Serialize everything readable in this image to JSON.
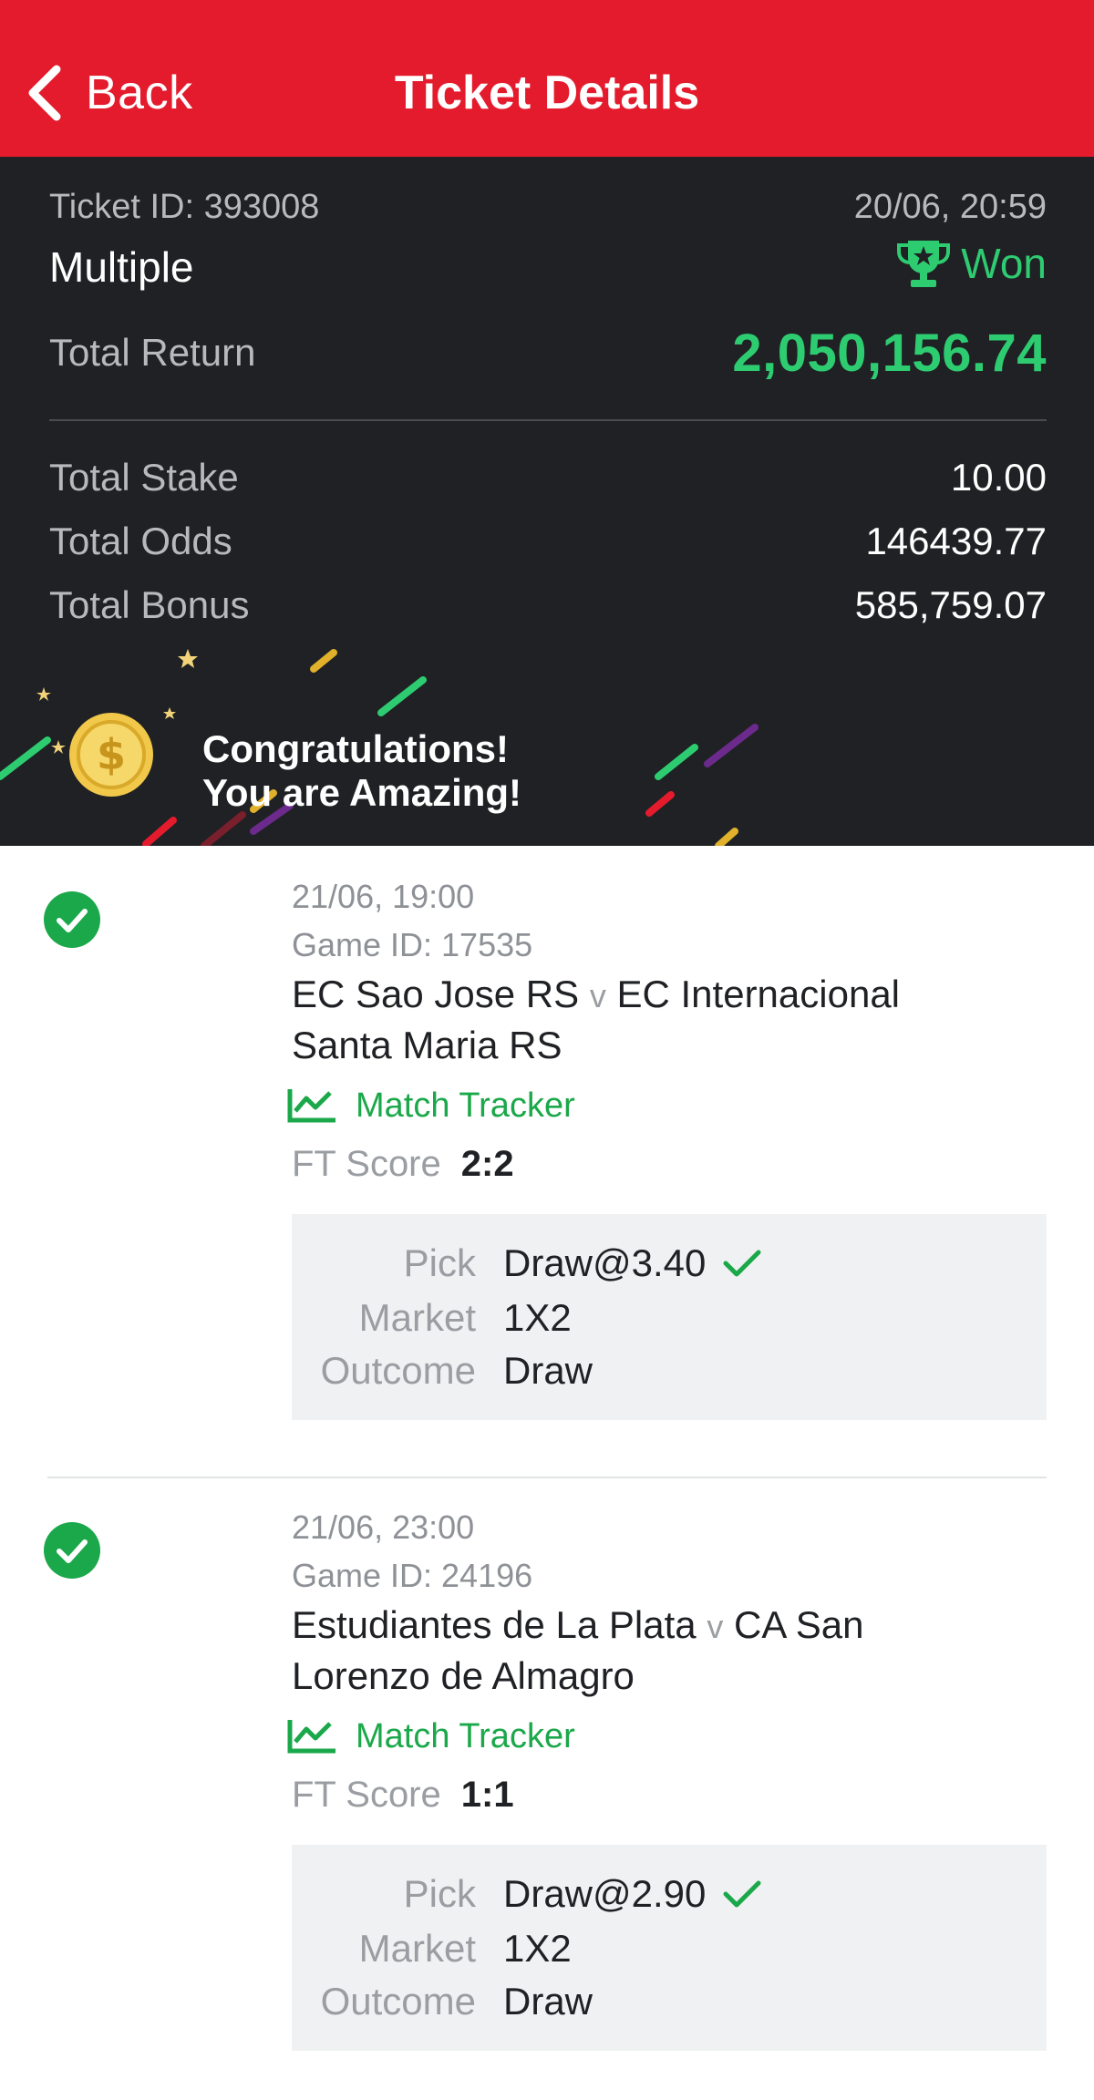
{
  "header": {
    "back_label": "Back",
    "title": "Ticket Details"
  },
  "summary": {
    "ticket_id": "Ticket ID: 393008",
    "datetime": "20/06, 20:59",
    "status": "Won",
    "type": "Multiple",
    "total_return_label": "Total Return",
    "total_return_value": "2,050,156.74",
    "stats": [
      {
        "label": "Total Stake",
        "value": "10.00"
      },
      {
        "label": "Total Odds",
        "value": "146439.77"
      },
      {
        "label": "Total Bonus",
        "value": "585,759.07"
      }
    ],
    "congrats_line1": "Congratulations!",
    "congrats_line2": "You are Amazing!"
  },
  "selections": [
    {
      "datetime": "21/06, 19:00",
      "game_id": "Game ID: 17535",
      "home": "EC Sao Jose RS",
      "vs": "v",
      "away_line1": "EC Internacional",
      "away_line2": "Santa Maria RS",
      "tracker_label": "Match Tracker",
      "ft_label": "FT Score",
      "ft_value": "2:2",
      "pick_label": "Pick",
      "pick_value": "Draw@3.40",
      "market_label": "Market",
      "market_value": "1X2",
      "outcome_label": "Outcome",
      "outcome_value": "Draw"
    },
    {
      "datetime": "21/06, 23:00",
      "game_id": "Game ID: 24196",
      "home": "Estudiantes de La Plata",
      "vs": "v",
      "away_line1": "CA San",
      "away_line2": "Lorenzo de Almagro",
      "tracker_label": "Match Tracker",
      "ft_label": "FT Score",
      "ft_value": "1:1",
      "pick_label": "Pick",
      "pick_value": "Draw@2.90",
      "market_label": "Market",
      "market_value": "1X2",
      "outcome_label": "Outcome",
      "outcome_value": "Draw"
    }
  ],
  "colors": {
    "header_red": "#e41b2c",
    "panel_dark": "#1f2124",
    "won_green": "#2ecc71",
    "check_green": "#1ba84a"
  },
  "icons": {
    "back": "chevron-left-icon",
    "won": "trophy-icon",
    "coin": "dollar-coin-icon",
    "check": "check-circle-icon",
    "tracker": "line-chart-icon",
    "pick_ok": "checkmark-icon"
  }
}
